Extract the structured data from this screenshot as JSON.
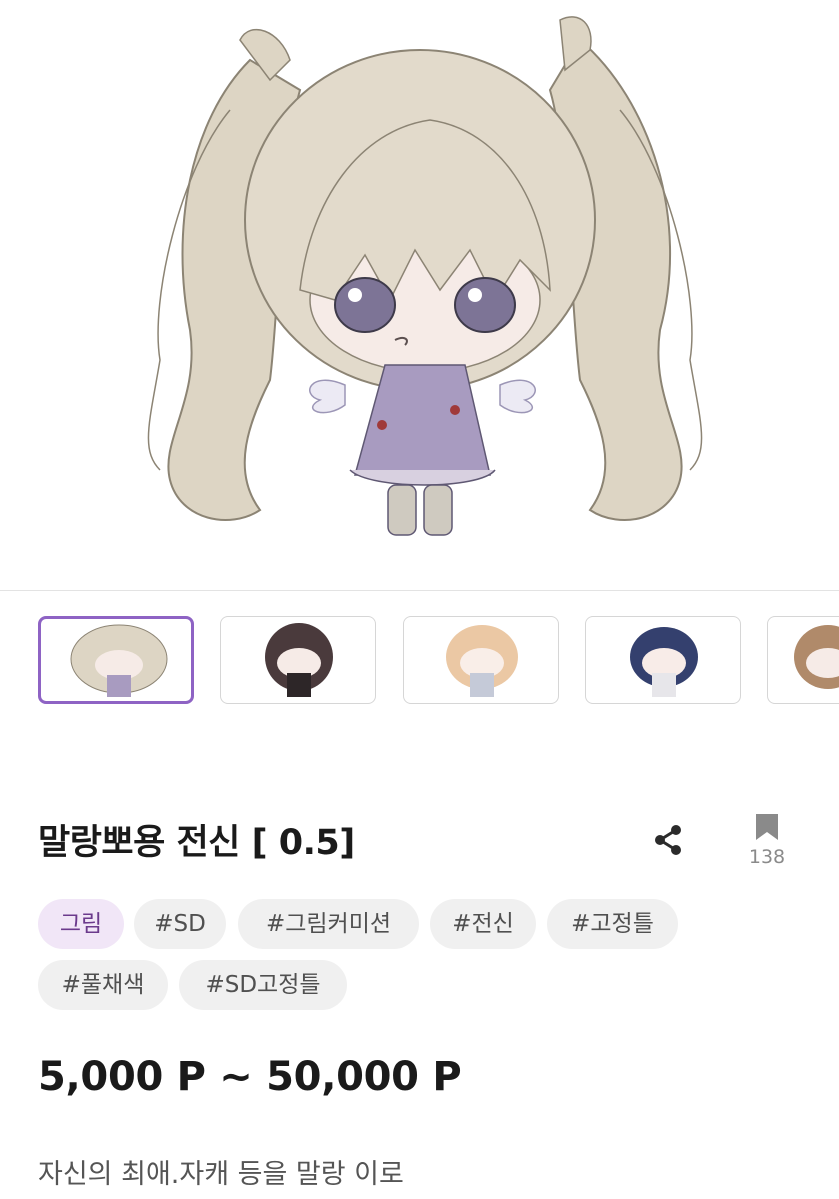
{
  "product": {
    "title": "말랑뽀용 전신 [ 0.5]",
    "bookmark_count": "138",
    "price": "5,000 P ~ 50,000 P",
    "description": "자신의 최애.자캐 등을 말랑 이로"
  },
  "tags": [
    {
      "label": "그림",
      "kind": "category"
    },
    {
      "label": "#SD",
      "kind": "hashtag"
    },
    {
      "label": "#그림커미션",
      "kind": "hashtag"
    },
    {
      "label": "#전신",
      "kind": "hashtag"
    },
    {
      "label": "#고정틀",
      "kind": "hashtag"
    },
    {
      "label": "#풀채색",
      "kind": "hashtag"
    },
    {
      "label": "#SD고정틀",
      "kind": "hashtag"
    }
  ],
  "thumbnails": [
    {
      "name": "thumbnail-1",
      "selected": true,
      "hair": "#d9d0bd",
      "dress": "#a89bc0"
    },
    {
      "name": "thumbnail-2",
      "selected": false,
      "hair": "#4a3a3c",
      "dress": "#2d2628"
    },
    {
      "name": "thumbnail-3",
      "selected": false,
      "hair": "#ebc8a4",
      "dress": "#c5cad8"
    },
    {
      "name": "thumbnail-4",
      "selected": false,
      "hair": "#34406e",
      "dress": "#e7e6ea"
    },
    {
      "name": "thumbnail-5",
      "selected": false,
      "hair": "#b08a6a",
      "dress": "#e9e3dc"
    }
  ],
  "colors": {
    "accent": "#8e63c4",
    "category_bg": "#f1e6f7",
    "category_text": "#6b3a8c",
    "tag_bg": "#f0f0f0",
    "icon": "#2b2b2b"
  },
  "icons": {
    "share": "share-icon",
    "bookmark": "bookmark-icon"
  }
}
